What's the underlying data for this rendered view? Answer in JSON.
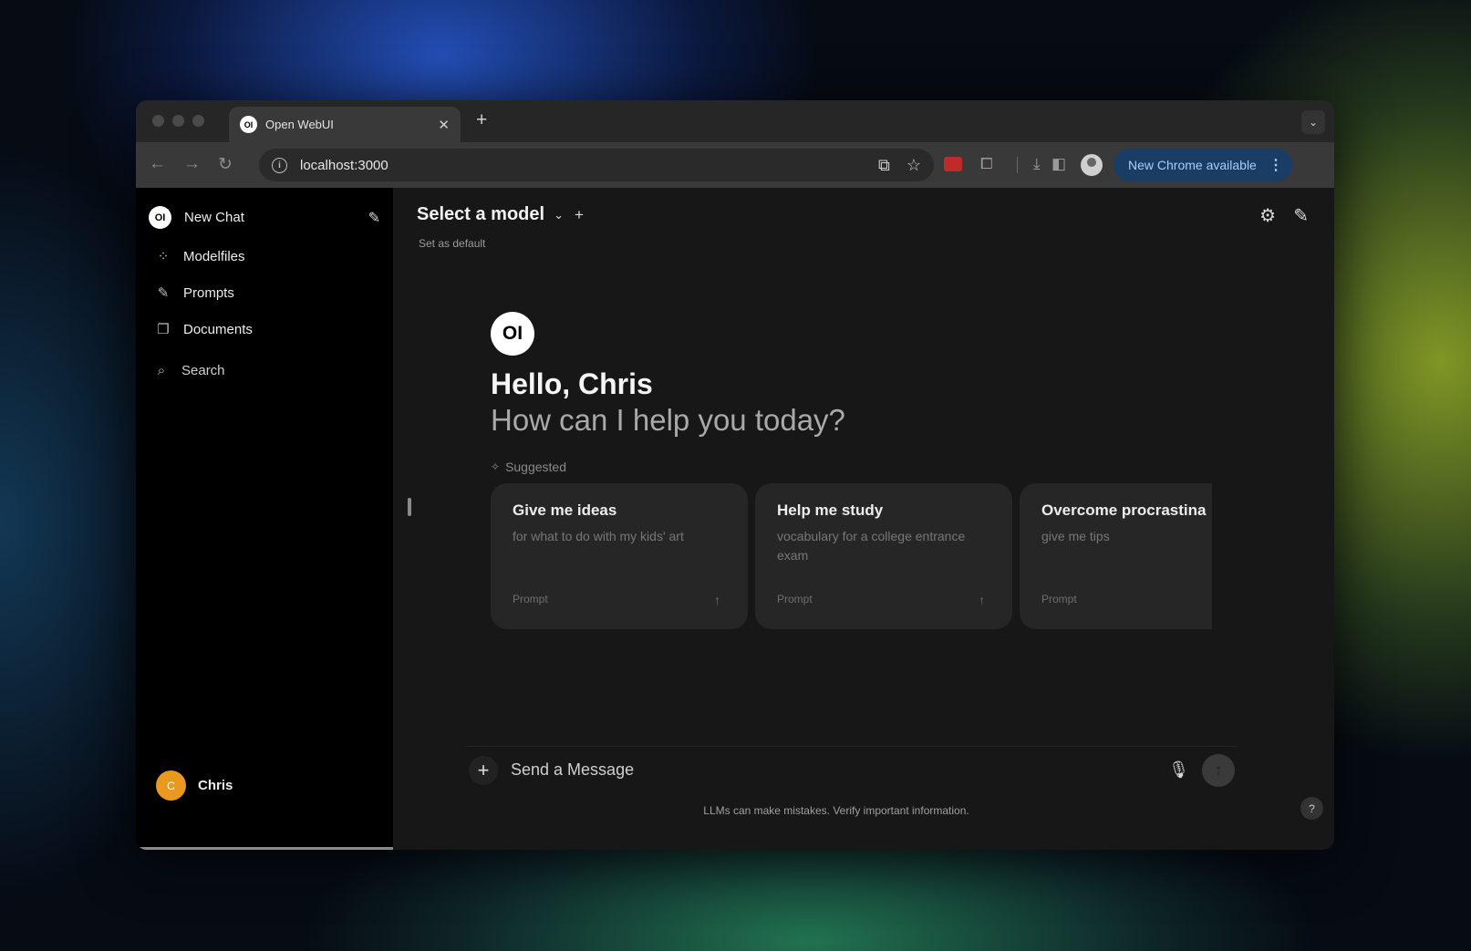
{
  "browser": {
    "tab_title": "Open WebUI",
    "tab_favicon_text": "OI",
    "url": "localhost:3000",
    "update_label": "New Chrome available",
    "icons": [
      "back-icon",
      "forward-icon",
      "reload-icon",
      "site-info-icon",
      "install-app-icon",
      "bookmark-star-icon",
      "extension-icon",
      "puzzle-icon",
      "download-icon",
      "side-panel-icon",
      "profile-avatar-icon",
      "more-vert-icon"
    ]
  },
  "sidebar": {
    "logo_text": "OI",
    "new_chat_label": "New Chat",
    "items": [
      {
        "label": "Modelfiles",
        "icon": "modelfiles-icon"
      },
      {
        "label": "Prompts",
        "icon": "pencil-icon"
      },
      {
        "label": "Documents",
        "icon": "documents-icon"
      }
    ],
    "search_label": "Search",
    "user": {
      "name": "Chris",
      "initial": "C",
      "avatar_color": "#e99a1e"
    }
  },
  "header": {
    "model_select_label": "Select a model",
    "set_default_label": "Set as default"
  },
  "welcome": {
    "logo_text": "OI",
    "greeting": "Hello, Chris",
    "subheading": "How can I help you today?",
    "suggested_label": "Suggested"
  },
  "suggestions": [
    {
      "title": "Give me ideas",
      "subtitle": "for what to do with my kids' art",
      "tag": "Prompt"
    },
    {
      "title": "Help me study",
      "subtitle": "vocabulary for a college entrance exam",
      "tag": "Prompt"
    },
    {
      "title": "Overcome procrastina",
      "subtitle": "give me tips",
      "tag": "Prompt"
    }
  ],
  "composer": {
    "placeholder": "Send a Message",
    "disclaimer": "LLMs can make mistakes. Verify important information.",
    "help_label": "?"
  },
  "colors": {
    "accent_blue_pill": "#1a3d66",
    "user_avatar": "#e99a1e",
    "sidebar_bg": "#000000",
    "main_bg": "#171717"
  }
}
